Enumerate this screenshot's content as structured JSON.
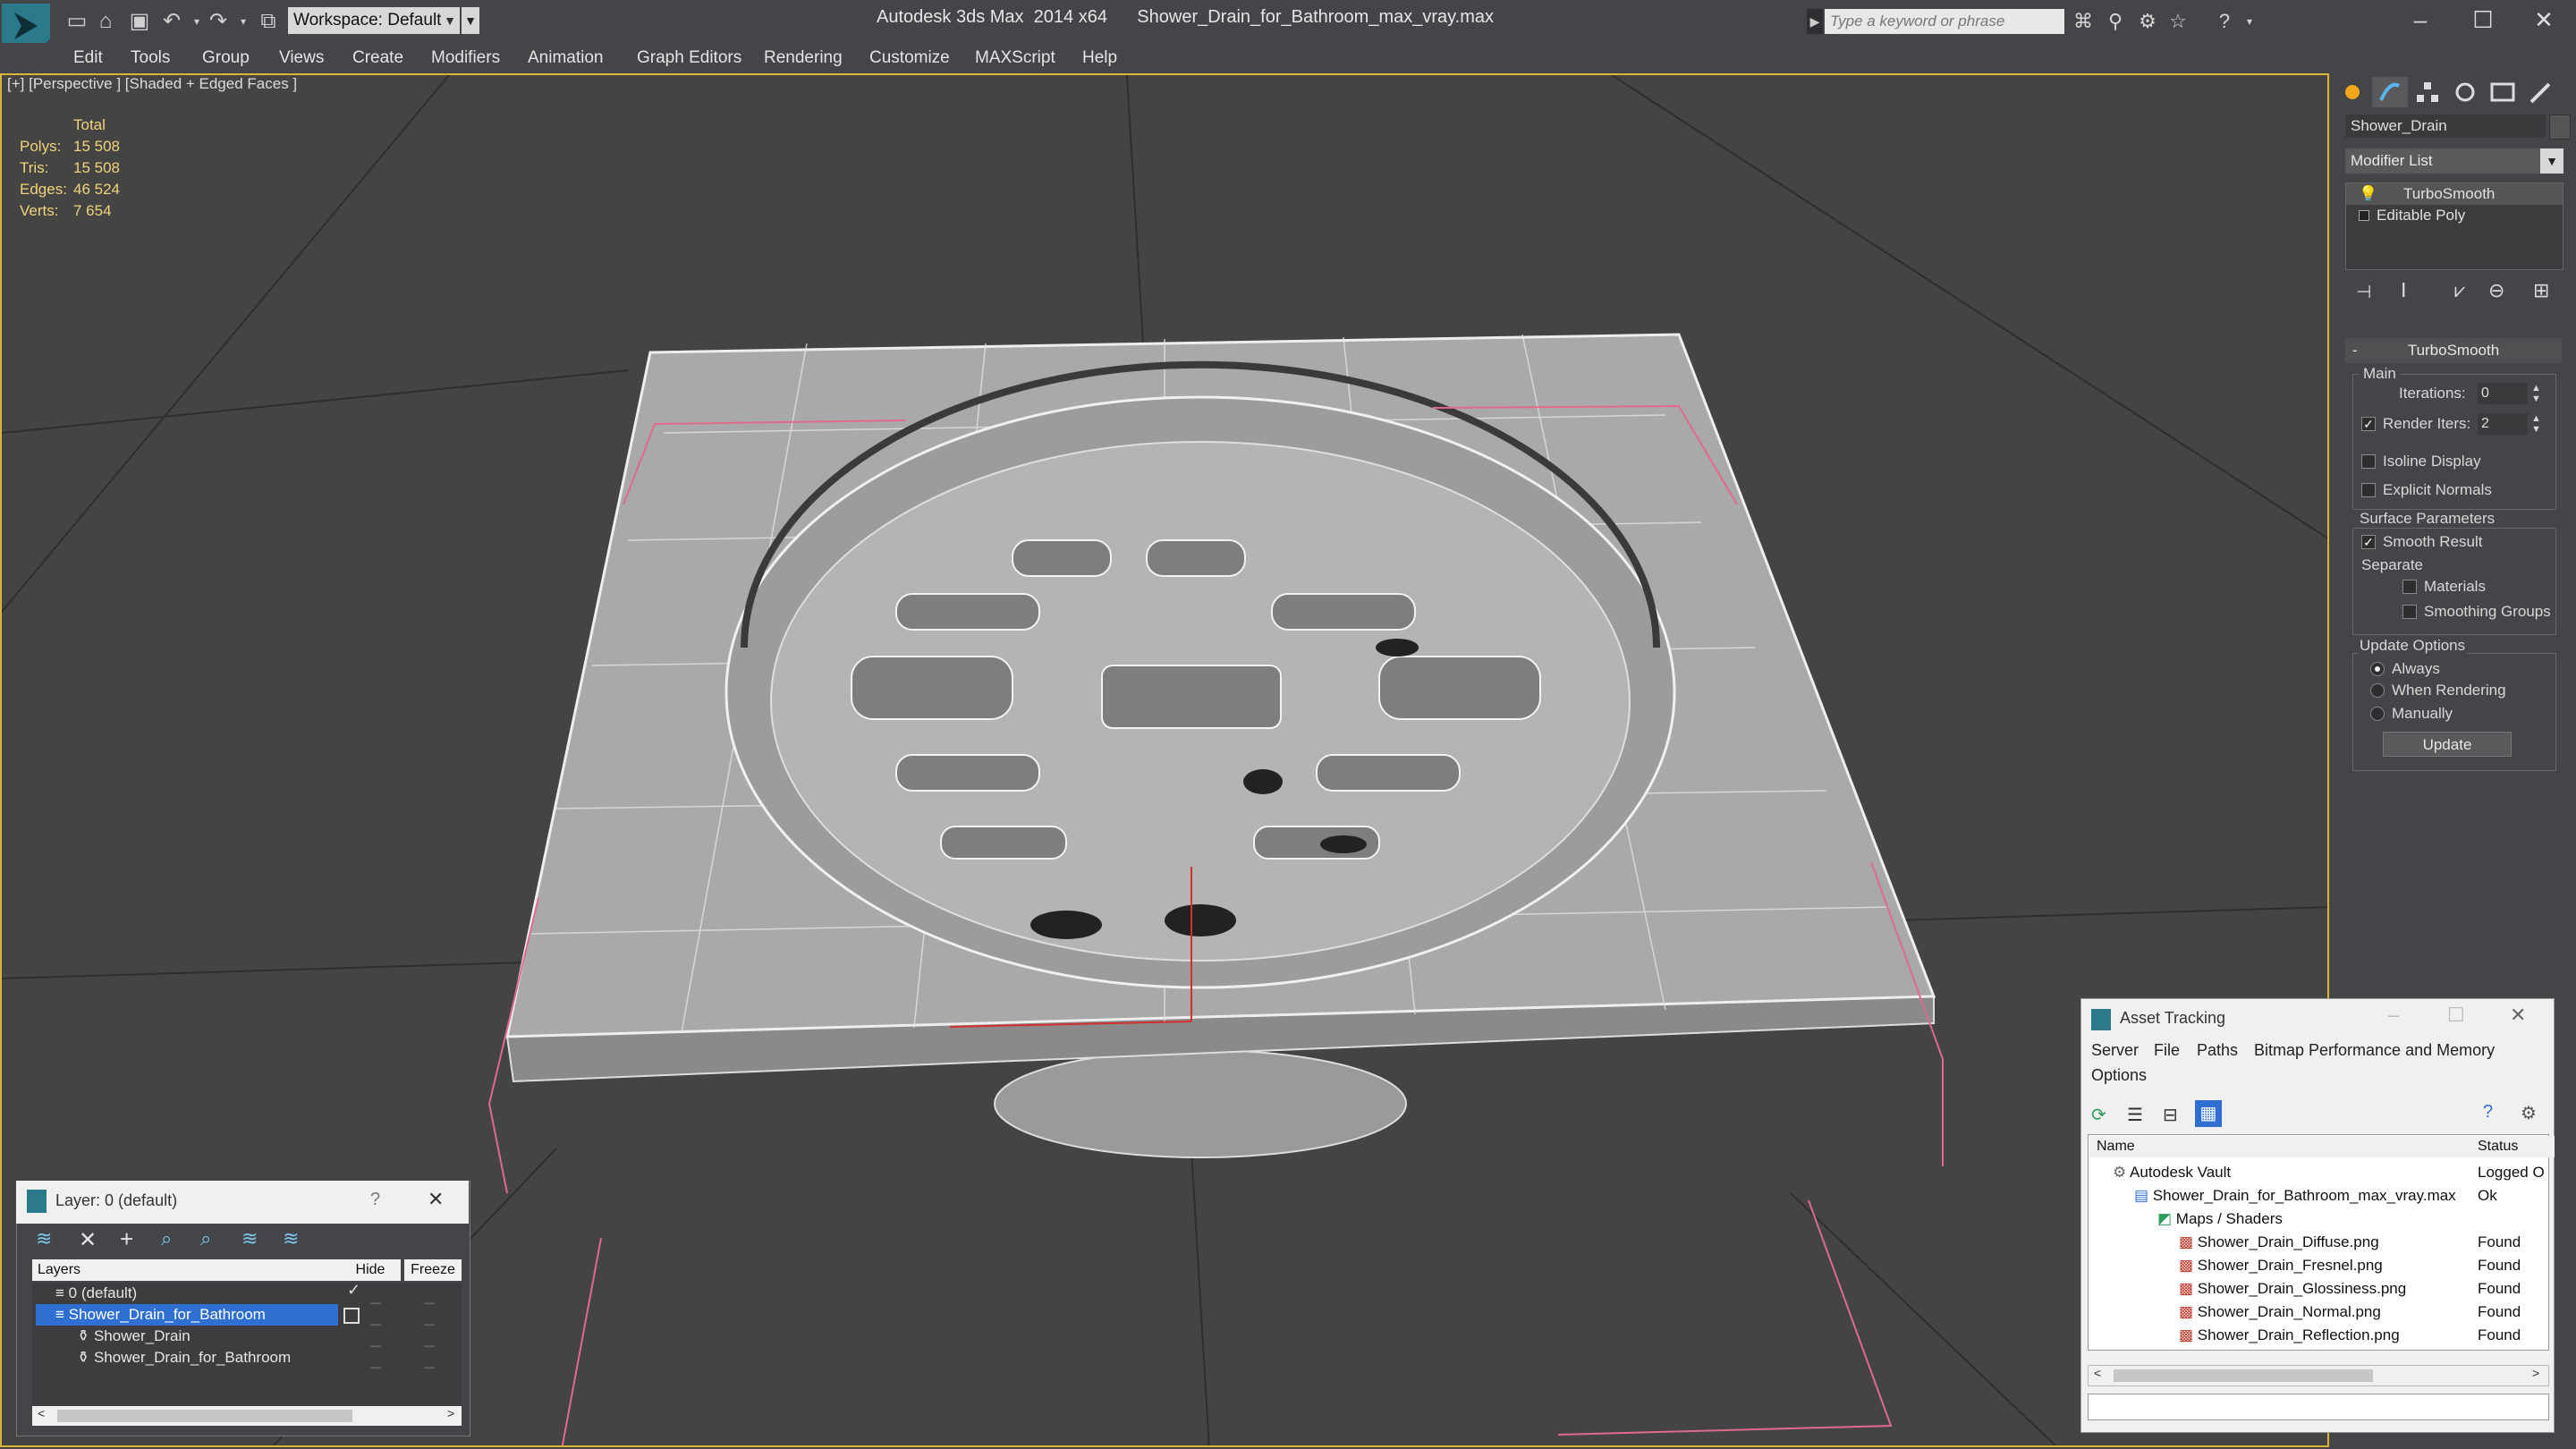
{
  "titlebar": {
    "workspace_label": "Workspace: Default",
    "app_name": "Autodesk 3ds Max  2014 x64",
    "file_name": "Shower_Drain_for_Bathroom_max_vray.max",
    "search_placeholder": "Type a keyword or phrase"
  },
  "menu": [
    "Edit",
    "Tools",
    "Group",
    "Views",
    "Create",
    "Modifiers",
    "Animation",
    "Graph Editors",
    "Rendering",
    "Customize",
    "MAXScript",
    "Help"
  ],
  "viewport": {
    "label": "[+] [Perspective ] [Shaded + Edged Faces ]",
    "stats_header": "Total",
    "stats": [
      {
        "label": "Polys:",
        "value": "15 508"
      },
      {
        "label": "Tris:",
        "value": "15 508"
      },
      {
        "label": "Edges:",
        "value": "46 524"
      },
      {
        "label": "Verts:",
        "value": "7 654"
      }
    ]
  },
  "command_panel": {
    "object_name": "Shower_Drain",
    "modifier_list": "Modifier List",
    "stack": [
      "TurboSmooth",
      "Editable Poly"
    ],
    "rollout_title": "TurboSmooth",
    "main_group": "Main",
    "iterations_label": "Iterations:",
    "iterations_value": "0",
    "render_iters_label": "Render Iters:",
    "render_iters_value": "2",
    "isoline_label": "Isoline Display",
    "explicit_normals_label": "Explicit Normals",
    "surface_group": "Surface Parameters",
    "smooth_result_label": "Smooth Result",
    "separate_label": "Separate",
    "materials_label": "Materials",
    "smoothing_groups_label": "Smoothing Groups",
    "update_group": "Update Options",
    "always_label": "Always",
    "when_rendering_label": "When Rendering",
    "manually_label": "Manually",
    "update_button": "Update"
  },
  "layer_dialog": {
    "title": "Layer: 0 (default)",
    "help": "?",
    "col_layers": "Layers",
    "col_hide": "Hide",
    "col_freeze": "Freeze",
    "rows": [
      "0 (default)",
      "Shower_Drain_for_Bathroom",
      "Shower_Drain",
      "Shower_Drain_for_Bathroom"
    ]
  },
  "asset_tracking": {
    "title": "Asset Tracking",
    "menu": [
      "Server",
      "File",
      "Paths",
      "Bitmap Performance and Memory"
    ],
    "menu2": "Options",
    "col_name": "Name",
    "col_status": "Status",
    "rows": [
      {
        "name": "Autodesk Vault",
        "status": "Logged O"
      },
      {
        "name": "Shower_Drain_for_Bathroom_max_vray.max",
        "status": "Ok"
      },
      {
        "name": "Maps / Shaders",
        "status": ""
      },
      {
        "name": "Shower_Drain_Diffuse.png",
        "status": "Found"
      },
      {
        "name": "Shower_Drain_Fresnel.png",
        "status": "Found"
      },
      {
        "name": "Shower_Drain_Glossiness.png",
        "status": "Found"
      },
      {
        "name": "Shower_Drain_Normal.png",
        "status": "Found"
      },
      {
        "name": "Shower_Drain_Reflection.png",
        "status": "Found"
      }
    ]
  }
}
